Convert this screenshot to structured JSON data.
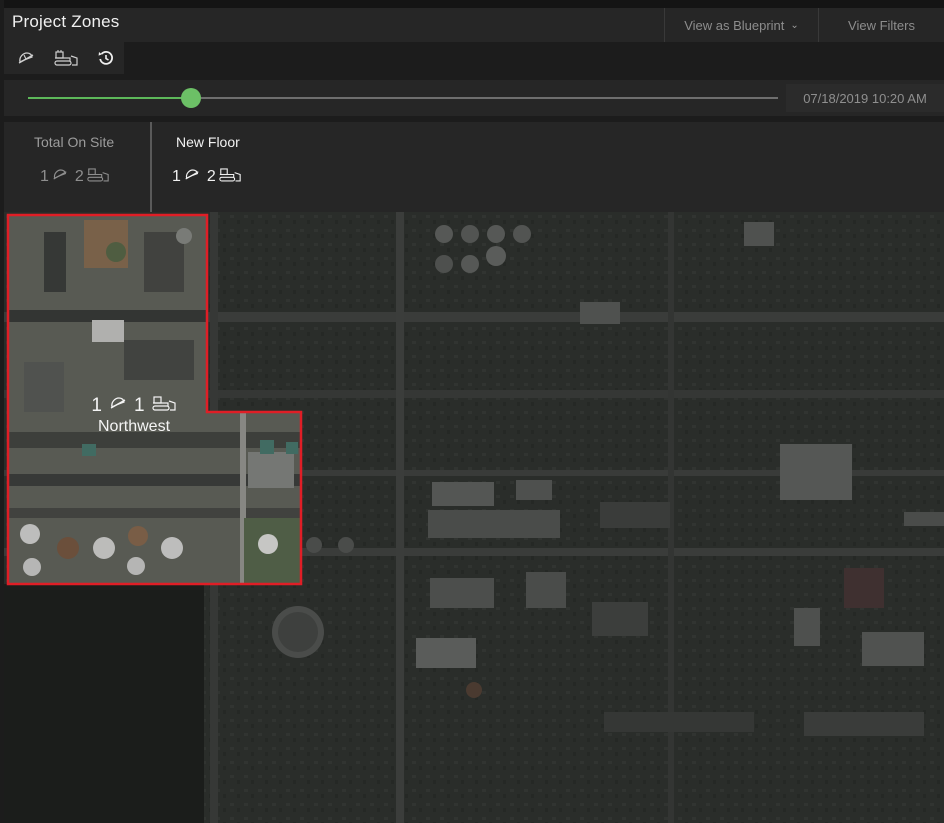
{
  "header": {
    "title": "Project Zones",
    "view_mode_label": "View as Blueprint",
    "filters_label": "View Filters"
  },
  "toolbar": {
    "icons": [
      "hard-hat-icon",
      "bulldozer-icon",
      "history-icon"
    ]
  },
  "timeline": {
    "progress": 0.218,
    "timestamp": "07/18/2019 10:20 AM"
  },
  "stats": {
    "total": {
      "label": "Total On Site",
      "workers": "1",
      "equipment": "2"
    },
    "floor": {
      "label": "New Floor",
      "workers": "1",
      "equipment": "2"
    }
  },
  "map": {
    "zone": {
      "name": "Northwest",
      "workers": "1",
      "equipment": "1",
      "outline_color": "#e01e26"
    }
  },
  "colors": {
    "accent_green": "#6cc066",
    "panel": "#262626"
  }
}
